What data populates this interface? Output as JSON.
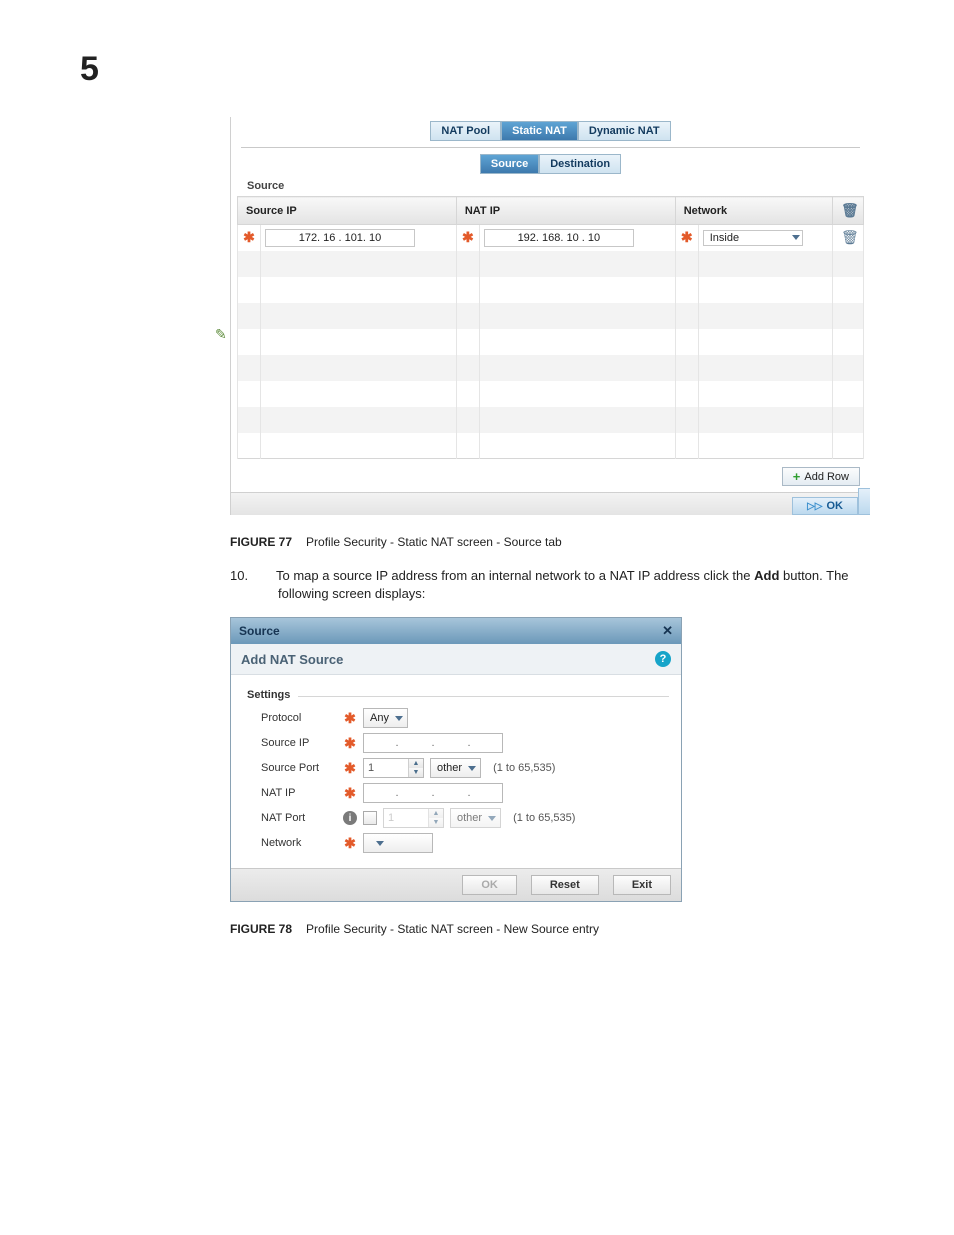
{
  "page_number": "5",
  "fig77": {
    "tabs_main": [
      "NAT Pool",
      "Static NAT",
      "Dynamic NAT"
    ],
    "tabs_main_active": 1,
    "tabs_sub": [
      "Source",
      "Destination"
    ],
    "tabs_sub_active": 0,
    "section_label": "Source",
    "columns": {
      "c1": "Source IP",
      "c2": "NAT IP",
      "c3": "Network"
    },
    "row": {
      "source_ip": "172. 16 . 101. 10",
      "nat_ip": "192. 168. 10 . 10",
      "network": "Inside"
    },
    "add_row_label": "Add Row",
    "ok_label": "OK"
  },
  "caption77": {
    "label": "FIGURE 77",
    "text": "Profile Security - Static NAT screen - Source tab"
  },
  "step10": {
    "num": "10.",
    "text_a": "To map a source IP address from an internal network to a NAT IP address click the ",
    "bold": "Add",
    "text_b": " button. The following screen displays:"
  },
  "fig78": {
    "title": "Source",
    "subtitle": "Add NAT Source",
    "fieldset": "Settings",
    "rows": {
      "protocol": {
        "label": "Protocol",
        "value": "Any"
      },
      "source_ip": {
        "label": "Source IP"
      },
      "source_port": {
        "label": "Source Port",
        "spin": "1",
        "sel": "other",
        "hint": "(1 to 65,535)"
      },
      "nat_ip": {
        "label": "NAT IP"
      },
      "nat_port": {
        "label": "NAT Port",
        "spin": "1",
        "sel": "other",
        "hint": "(1 to 65,535)"
      },
      "network": {
        "label": "Network",
        "value": ""
      }
    },
    "buttons": {
      "ok": "OK",
      "reset": "Reset",
      "exit": "Exit"
    }
  },
  "caption78": {
    "label": "FIGURE 78",
    "text": "Profile Security - Static NAT screen - New Source entry"
  }
}
